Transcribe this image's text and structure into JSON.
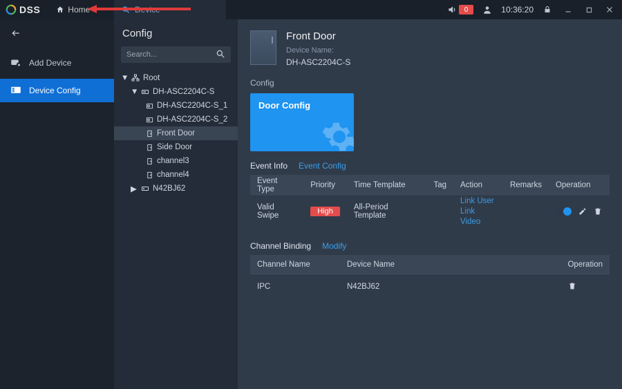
{
  "titlebar": {
    "brand": "DSS",
    "home": "Home",
    "tab": "Device",
    "badge": "0",
    "time": "10:36:20"
  },
  "sidebar": {
    "items": [
      {
        "label": "Add Device"
      },
      {
        "label": "Device Config"
      }
    ]
  },
  "tree": {
    "title": "Config",
    "search_placeholder": "Search...",
    "root": {
      "label": "Root",
      "children": [
        {
          "label": "DH-ASC2204C-S",
          "children": [
            {
              "label": "DH-ASC2204C-S_1"
            },
            {
              "label": "DH-ASC2204C-S_2"
            },
            {
              "label": "Front Door"
            },
            {
              "label": "Side Door"
            },
            {
              "label": "channel3"
            },
            {
              "label": "channel4"
            }
          ]
        },
        {
          "label": "N42BJ62"
        }
      ]
    }
  },
  "main": {
    "title": "Front Door",
    "name_label": "Device Name:",
    "name_value": "DH-ASC2204C-S",
    "config_label": "Config",
    "door_config": "Door Config",
    "event_info_label": "Event Info",
    "event_config_link": "Event Config",
    "event_cols": [
      "Event Type",
      "Priority",
      "Time Template",
      "Tag",
      "Action",
      "Remarks",
      "Operation"
    ],
    "event_rows": [
      {
        "type": "Valid Swipe",
        "priority": "High",
        "time_template": "All-Period Template",
        "tag": "",
        "actions": [
          "Link User",
          "Link Video"
        ],
        "remarks": ""
      }
    ],
    "channel_binding_label": "Channel Binding",
    "modify_link": "Modify",
    "channel_cols": [
      "Channel Name",
      "Device Name",
      "Operation"
    ],
    "channel_rows": [
      {
        "channel": "IPC",
        "device": "N42BJ62"
      }
    ]
  }
}
